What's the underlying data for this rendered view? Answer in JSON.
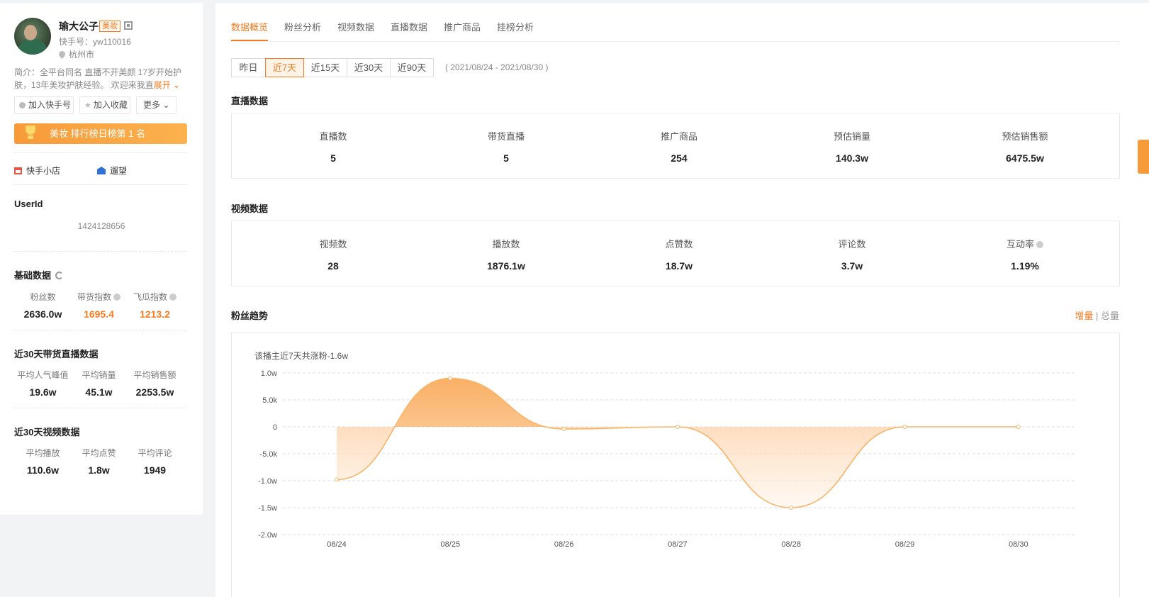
{
  "profile": {
    "name": "瑜大公子",
    "tag": "美妆",
    "kuaishou_id": "快手号：yw110016",
    "location": "杭州市",
    "intro": "简介：全平台同名 直播不开美颜 17岁开始护肤，13年美妆护肤经验。 欢迎来我直",
    "expand_label": "展开"
  },
  "actions": {
    "add_kuaishou": "加入快手号",
    "add_favorite": "加入收藏",
    "more": "更多"
  },
  "rank_banner": "美妆 排行榜日榜第 1 名",
  "links": {
    "shop": "快手小店",
    "other": "遛望"
  },
  "userid": {
    "title": "UserId",
    "value": "1424128656"
  },
  "basic": {
    "title": "基础数据",
    "items": [
      {
        "label": "粉丝数",
        "value": "2636.0w"
      },
      {
        "label": "带货指数",
        "value": "1695.4"
      },
      {
        "label": "飞瓜指数",
        "value": "1213.2"
      }
    ]
  },
  "live30": {
    "title": "近30天带货直播数据",
    "items": [
      {
        "label": "平均人气峰值",
        "value": "19.6w"
      },
      {
        "label": "平均销量",
        "value": "45.1w"
      },
      {
        "label": "平均销售额",
        "value": "2253.5w"
      }
    ]
  },
  "video30": {
    "title": "近30天视频数据",
    "items": [
      {
        "label": "平均播放",
        "value": "110.6w"
      },
      {
        "label": "平均点赞",
        "value": "1.8w"
      },
      {
        "label": "平均评论",
        "value": "1949"
      }
    ]
  },
  "tabs": [
    "数据概览",
    "粉丝分析",
    "视频数据",
    "直播数据",
    "推广商品",
    "挂榜分析"
  ],
  "ranges": [
    "昨日",
    "近7天",
    "近15天",
    "近30天",
    "近90天"
  ],
  "active_range": 1,
  "date_range": "( 2021/08/24 - 2021/08/30 )",
  "live_section": {
    "title": "直播数据",
    "metrics": [
      {
        "label": "直播数",
        "value": "5"
      },
      {
        "label": "带货直播",
        "value": "5"
      },
      {
        "label": "推广商品",
        "value": "254"
      },
      {
        "label": "预估销量",
        "value": "140.3w"
      },
      {
        "label": "预估销售额",
        "value": "6475.5w"
      }
    ]
  },
  "video_section": {
    "title": "视频数据",
    "metrics": [
      {
        "label": "视频数",
        "value": "28"
      },
      {
        "label": "播放数",
        "value": "1876.1w"
      },
      {
        "label": "点赞数",
        "value": "18.7w"
      },
      {
        "label": "评论数",
        "value": "3.7w"
      },
      {
        "label": "互动率",
        "value": "1.19%"
      }
    ]
  },
  "fans_trend": {
    "title": "粉丝趋势",
    "toggle_increment": "增量",
    "toggle_separator": "|",
    "toggle_total": "总量",
    "note": "该播主近7天共涨粉-1.6w"
  },
  "colors": {
    "accent": "#f47b20",
    "line": "#f9b46a"
  },
  "chart_data": {
    "type": "area",
    "categories": [
      "08/24",
      "08/25",
      "08/26",
      "08/27",
      "08/28",
      "08/29",
      "08/30"
    ],
    "series": [
      {
        "values": [
          -9800,
          9000,
          -400,
          0,
          -15000,
          0,
          0
        ]
      }
    ],
    "yticks": [
      10000,
      5000,
      0,
      -5000,
      -10000,
      -15000,
      -20000
    ],
    "ytick_labels": [
      "1.0w",
      "5.0k",
      "0",
      "-5.0k",
      "-1.0w",
      "-1.5w",
      "-2.0w"
    ],
    "ylim": [
      -20000,
      10000
    ],
    "grid": true
  }
}
